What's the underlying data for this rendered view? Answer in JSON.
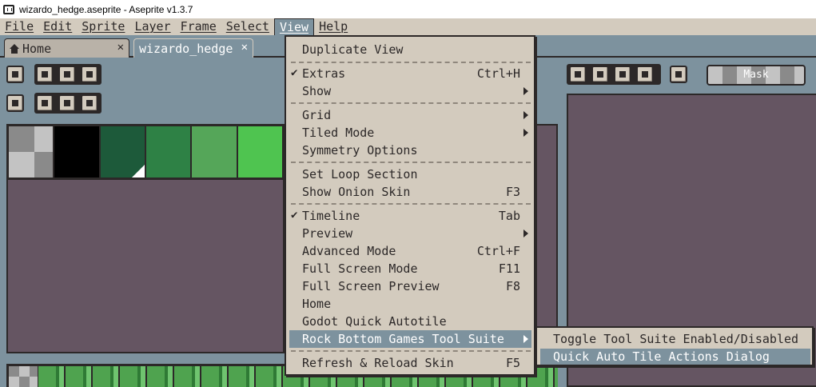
{
  "window": {
    "title": "wizardo_hedge.aseprite - Aseprite v1.3.7"
  },
  "menubar": [
    "File",
    "Edit",
    "Sprite",
    "Layer",
    "Frame",
    "Select",
    "View",
    "Help"
  ],
  "tabs": {
    "home": "Home",
    "document": "wizardo_hedge"
  },
  "right_toolbar": {
    "mask_label": "Mask"
  },
  "palette": {
    "colors": [
      "transparent",
      "#000000",
      "#1d5a3a",
      "#2e8145",
      "#55a659",
      "#4fc450"
    ]
  },
  "view_menu": {
    "items": [
      {
        "label": "Duplicate View",
        "shortcut": ""
      },
      {
        "label": "Extras",
        "shortcut": "Ctrl+H",
        "checked": true
      },
      {
        "label": "Show",
        "submenu": true
      },
      {
        "label": "Grid",
        "submenu": true
      },
      {
        "label": "Tiled Mode",
        "submenu": true
      },
      {
        "label": "Symmetry Options",
        "shortcut": ""
      },
      {
        "label": "Set Loop Section",
        "shortcut": ""
      },
      {
        "label": "Show Onion Skin",
        "shortcut": "F3"
      },
      {
        "label": "Timeline",
        "shortcut": "Tab",
        "checked": true
      },
      {
        "label": "Preview",
        "submenu": true
      },
      {
        "label": "Advanced Mode",
        "shortcut": "Ctrl+F"
      },
      {
        "label": "Full Screen Mode",
        "shortcut": "F11"
      },
      {
        "label": "Full Screen Preview",
        "shortcut": "F8"
      },
      {
        "label": "Home",
        "shortcut": ""
      },
      {
        "label": "Godot Quick Autotile",
        "shortcut": ""
      },
      {
        "label": "Rock Bottom Games Tool Suite",
        "submenu": true,
        "highlighted": true
      },
      {
        "label": "Refresh & Reload Skin",
        "shortcut": "F5"
      }
    ]
  },
  "submenu": {
    "items": [
      {
        "label": "Toggle Tool Suite Enabled/Disabled"
      },
      {
        "label": "Quick Auto Tile Actions Dialog",
        "highlighted": true
      }
    ]
  }
}
